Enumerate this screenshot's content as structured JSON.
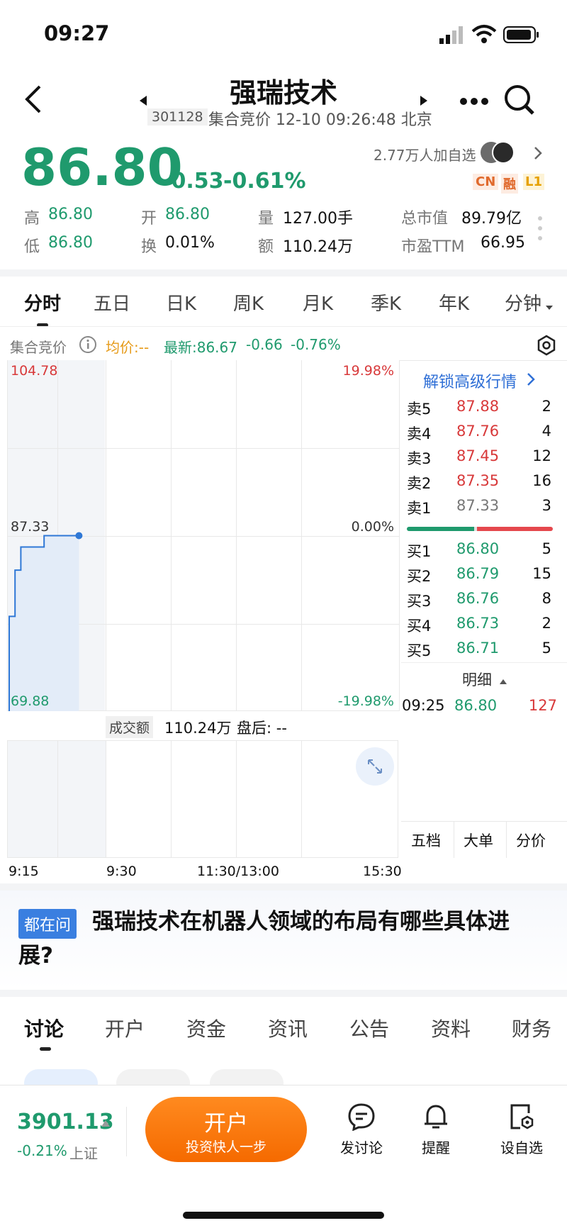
{
  "status": {
    "time": "09:27"
  },
  "header": {
    "title": "强瑞技术",
    "code": "301128",
    "subtitle": "集合竞价 12-10 09:26:48 北京"
  },
  "quote": {
    "price": "86.80",
    "change": "-0.53",
    "change_pct": "-0.61%",
    "watchers": "2.77万人加自选",
    "badges": [
      "CN",
      "融",
      "L1"
    ],
    "high_label": "高",
    "high": "86.80",
    "open_label": "开",
    "open": "86.80",
    "vol_label": "量",
    "vol": "127.00手",
    "mcap_label": "总市值",
    "mcap": "89.79亿",
    "low_label": "低",
    "low": "86.80",
    "turn_label": "换",
    "turn": "0.01%",
    "amt_label": "额",
    "amt": "110.24万",
    "pe_label": "市盈TTM",
    "pe": "66.95"
  },
  "chart_tabs": [
    "分时",
    "五日",
    "日K",
    "周K",
    "月K",
    "季K",
    "年K",
    "分钟"
  ],
  "info_bar": {
    "mode": "集合竞价",
    "avg": "均价:--",
    "latest": "最新:86.67",
    "chg": "-0.66",
    "pct": "-0.76%"
  },
  "chart_data": {
    "type": "line",
    "ylabels": {
      "top": "104.78",
      "mid": "87.33",
      "bottom": "69.88"
    },
    "pct_labels": {
      "top": "19.98%",
      "mid": "0.00%",
      "bottom": "-19.98%"
    },
    "x_labels": [
      "9:15",
      "9:30",
      "11:30/13:00",
      "15:30"
    ],
    "ylim": [
      69.88,
      104.78
    ],
    "x": [
      "9:15",
      "9:15",
      "9:16",
      "9:16",
      "9:17",
      "9:17",
      "9:21",
      "9:21",
      "9:25",
      "9:25",
      "9:27"
    ],
    "y": [
      69.88,
      79.3,
      79.3,
      83.9,
      83.9,
      86.2,
      86.2,
      87.33,
      87.33,
      87.33,
      87.33
    ]
  },
  "volume_bar": {
    "label": "成交额",
    "value": "110.24万",
    "after": "盘后: --"
  },
  "orderbook": {
    "unlock": "解锁高级行情",
    "asks": [
      {
        "label": "卖5",
        "price": "87.88",
        "vol": "2"
      },
      {
        "label": "卖4",
        "price": "87.76",
        "vol": "4"
      },
      {
        "label": "卖3",
        "price": "87.45",
        "vol": "12"
      },
      {
        "label": "卖2",
        "price": "87.35",
        "vol": "16"
      },
      {
        "label": "卖1",
        "price": "87.33",
        "vol": "3"
      }
    ],
    "bids": [
      {
        "label": "买1",
        "price": "86.80",
        "vol": "5"
      },
      {
        "label": "买2",
        "price": "86.79",
        "vol": "15"
      },
      {
        "label": "买3",
        "price": "86.76",
        "vol": "8"
      },
      {
        "label": "买4",
        "price": "86.73",
        "vol": "2"
      },
      {
        "label": "买5",
        "price": "86.71",
        "vol": "5"
      }
    ],
    "detail_label": "明细",
    "trade": {
      "time": "09:25",
      "price": "86.80",
      "vol": "127"
    },
    "tabs": [
      "五档",
      "大单",
      "分价"
    ]
  },
  "question": {
    "badge": "都在问",
    "text": "强瑞技术在机器人领域的布局有哪些具体进展?"
  },
  "sub_tabs": [
    "讨论",
    "开户",
    "资金",
    "资讯",
    "公告",
    "资料",
    "财务"
  ],
  "bottom": {
    "index": "3901.13",
    "index_pct": "-0.21%",
    "index_name": "上证",
    "open_btn": "开户",
    "open_sub": "投资快人一步",
    "discuss": "发讨论",
    "alert": "提醒",
    "watch": "设自选"
  }
}
